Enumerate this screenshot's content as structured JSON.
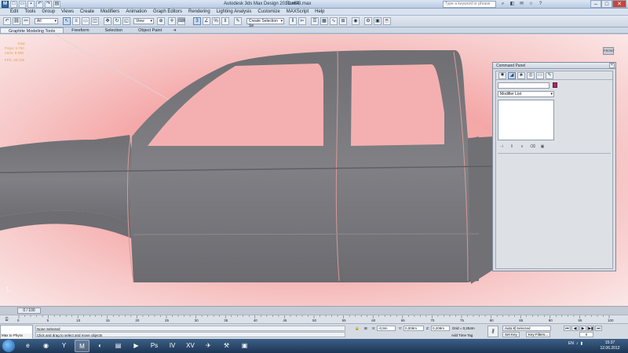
{
  "window": {
    "title": "Autodesk 3ds Max Design 2012 x64",
    "file": "Ram03.max",
    "search_placeholder": "Type a keyword or phrase"
  },
  "menu": [
    "Edit",
    "Tools",
    "Group",
    "Views",
    "Create",
    "Modifiers",
    "Animation",
    "Graph Editors",
    "Rendering",
    "Lighting Analysis",
    "Customize",
    "MAXScript",
    "Help"
  ],
  "toolbar": {
    "selection_filter": "All",
    "reference_coord": "View",
    "named_selection_placeholder": "Create Selection Se"
  },
  "ribbon": {
    "tabs": [
      "Graphite Modeling Tools",
      "Freeform",
      "Selection",
      "Object Paint"
    ],
    "toggle": "◦▾"
  },
  "viewport": {
    "stats": {
      "header": "Total",
      "polys_label": "Polys:",
      "polys_value": "9 750",
      "verts_label": "Verts:",
      "verts_value": "9 680",
      "fps_label": "FPS:",
      "fps_value": "39,726"
    },
    "viewcube_label": "FRONT",
    "axis_label": "Z"
  },
  "command_panel": {
    "title": "Command Panel",
    "modifier_list": "Modifier List",
    "tabs": [
      "create-icon",
      "modify-icon",
      "hierarchy-icon",
      "motion-icon",
      "display-icon",
      "utilities-icon"
    ]
  },
  "timeline": {
    "slider_label": "0 / 100",
    "ticks": [
      "0",
      "5",
      "10",
      "15",
      "20",
      "25",
      "30",
      "35",
      "40",
      "45",
      "50",
      "55",
      "60",
      "65",
      "70",
      "75",
      "80",
      "85",
      "90",
      "95",
      "100"
    ]
  },
  "status": {
    "listener_text": "Max to Physx",
    "selection": "None Selected",
    "prompt": "Click and drag to select and move objects",
    "x_label": "X:",
    "x_value": "-0,9m",
    "y_label": "Y:",
    "y_value": "0,009m",
    "z_label": "Z:",
    "z_value": "0,209m",
    "grid": "Grid = 0,254m",
    "add_time_tag": "Add Time Tag",
    "auto_key": "Auto Key",
    "set_key": "Set Key",
    "selected": "Selected",
    "key_filters": "Key Filters...",
    "frame": "0"
  },
  "taskbar": {
    "time": "15:37",
    "date": "12.06.2012",
    "tray_lang": "EN"
  }
}
